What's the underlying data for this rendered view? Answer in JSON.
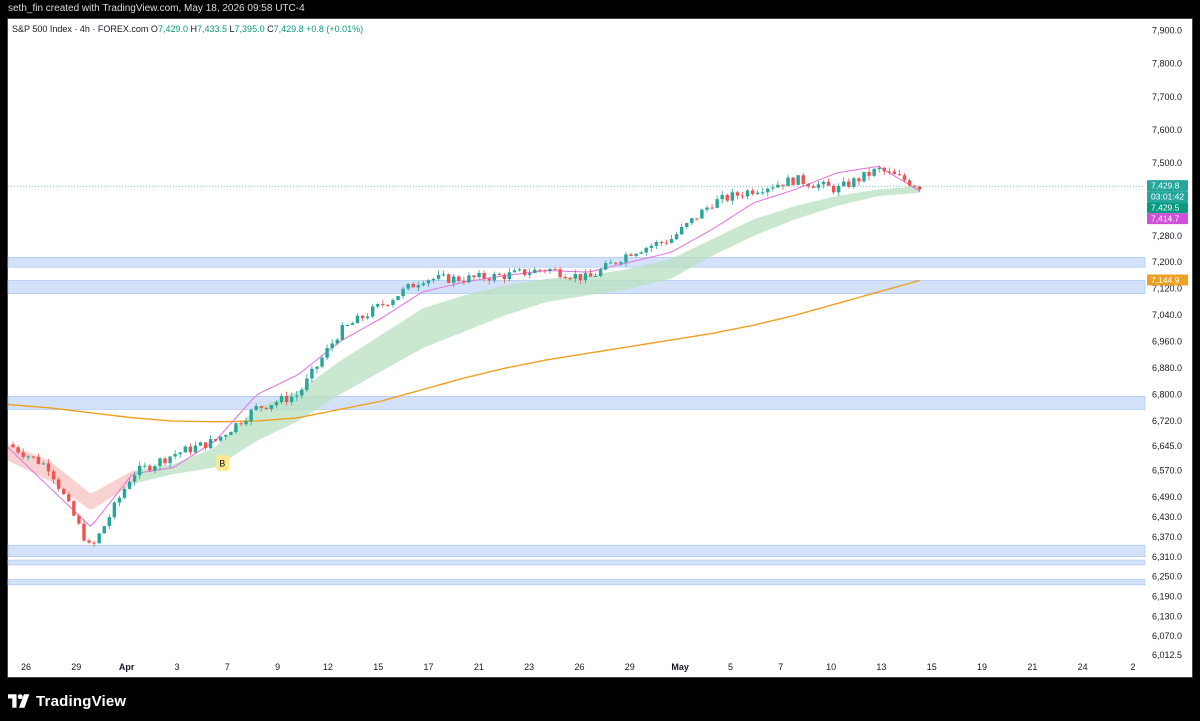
{
  "header": {
    "credit": "seth_fin created with TradingView.com, May 18, 2026 09:58 UTC-4"
  },
  "legend": {
    "symbol": "S&P 500 Index · 4h · FOREX.com",
    "o_label": "O",
    "o": "7,429.0",
    "h_label": "H",
    "h": "7,433.5",
    "l_label": "L",
    "l": "7,395.0",
    "c_label": "C",
    "c": "7,429.8",
    "change": "+0.8 (+0.01%)"
  },
  "footer": {
    "brand": "TradingView"
  },
  "colors": {
    "up": "#26a69a",
    "down": "#ef5350",
    "ma_fast": "#e37be0",
    "ma_slow": "#f0a020",
    "cloud_up": "#b8e0c0",
    "cloud_down": "#f6c6c6",
    "zone": "#c9dcf7",
    "zone_edge": "#8fb4ec"
  },
  "chart_data": {
    "type": "candlestick",
    "title": "S&P 500 Index · 4h · FOREX.com",
    "xlabel": "",
    "ylabel": "",
    "ylim": [
      5995,
      7935
    ],
    "y_ticks": [
      "7,900.0",
      "7,800.0",
      "7,700.0",
      "7,600.0",
      "7,500.0",
      "7,280.0",
      "7,200.0",
      "7,120.0",
      "7,040.0",
      "6,960.0",
      "6,880.0",
      "6,800.0",
      "6,720.0",
      "6,645.0",
      "6,570.0",
      "6,490.0",
      "6,430.0",
      "6,370.0",
      "6,310.0",
      "6,250.0",
      "6,190.0",
      "6,130.0",
      "6,070.0",
      "6,012.5"
    ],
    "x_ticks": [
      "26",
      "29",
      "Apr",
      "3",
      "7",
      "9",
      "12",
      "15",
      "17",
      "21",
      "23",
      "26",
      "29",
      "May",
      "5",
      "7",
      "10",
      "13",
      "15",
      "19",
      "21",
      "24",
      "2"
    ],
    "price_labels": [
      {
        "text": "7,429.8",
        "kind": "last",
        "color": "#26a69a"
      },
      {
        "text": "03:01:42",
        "kind": "countdown",
        "color": "#26a69a"
      },
      {
        "text": "7,429.5",
        "kind": "ma",
        "color": "#089981"
      },
      {
        "text": "7,414.7",
        "kind": "ma_fast",
        "color": "#d04fd9"
      },
      {
        "text": "7,144.9",
        "kind": "ma_slow",
        "color": "#f0a020"
      }
    ],
    "signal_marker": {
      "text": "B",
      "at_x_index": 4
    },
    "zones": [
      {
        "low": 7185,
        "high": 7215
      },
      {
        "low": 7105,
        "high": 7145
      },
      {
        "low": 6755,
        "high": 6795
      },
      {
        "low": 6310,
        "high": 6345
      },
      {
        "low": 6285,
        "high": 6300
      },
      {
        "low": 6225,
        "high": 6242
      }
    ],
    "series": [
      {
        "name": "MA slow",
        "values": [
          6770,
          6760,
          6745,
          6730,
          6720,
          6718,
          6720,
          6730,
          6755,
          6780,
          6815,
          6850,
          6880,
          6905,
          6925,
          6945,
          6965,
          6985,
          7010,
          7040,
          7075,
          7110,
          7145
        ]
      },
      {
        "name": "MA fast",
        "values": [
          6640,
          6520,
          6400,
          6560,
          6580,
          6660,
          6800,
          6860,
          6960,
          7030,
          7110,
          7140,
          7160,
          7175,
          7170,
          7200,
          7230,
          7300,
          7380,
          7420,
          7470,
          7490,
          7415
        ]
      },
      {
        "name": "Cloud upper",
        "values": [
          6650,
          6600,
          6500,
          6570,
          6590,
          6640,
          6760,
          6810,
          6900,
          6980,
          7060,
          7100,
          7130,
          7150,
          7160,
          7180,
          7210,
          7270,
          7330,
          7370,
          7400,
          7420,
          7430
        ]
      },
      {
        "name": "Cloud lower",
        "values": [
          6600,
          6540,
          6450,
          6530,
          6560,
          6580,
          6660,
          6720,
          6800,
          6870,
          6940,
          6990,
          7040,
          7080,
          7100,
          7120,
          7150,
          7220,
          7280,
          7330,
          7370,
          7400,
          7410
        ]
      },
      {
        "name": "Close",
        "values": [
          6650,
          6580,
          6330,
          6560,
          6620,
          6660,
          6760,
          6800,
          6990,
          7070,
          7150,
          7150,
          7160,
          7180,
          7150,
          7230,
          7270,
          7380,
          7420,
          7450,
          7420,
          7480,
          7429.8
        ]
      }
    ]
  }
}
